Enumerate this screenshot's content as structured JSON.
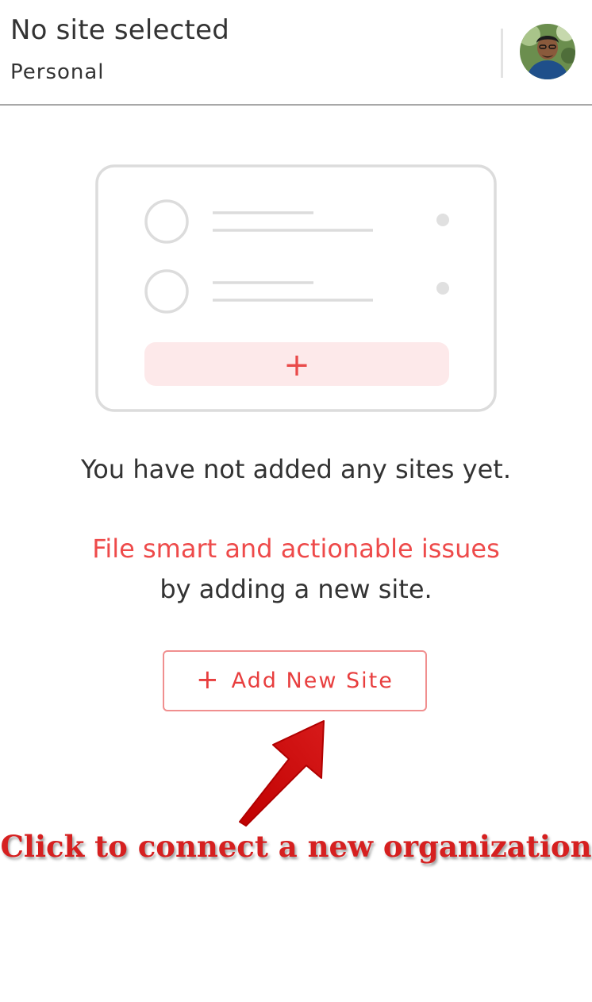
{
  "header": {
    "site_title": "No site selected",
    "site_subtitle": "Personal",
    "avatar_icon": "user-avatar"
  },
  "illustration": {
    "icon": "empty-sites-illustration",
    "plus_symbol": "+"
  },
  "empty_state": {
    "message": "You have not added any sites yet.",
    "promo_highlight": "File smart and actionable issues",
    "promo_rest": "by adding a new site."
  },
  "add_button": {
    "icon": "plus-icon",
    "plus": "+",
    "label": "Add New Site"
  },
  "annotation": {
    "text": "Click to connect a new organization",
    "arrow_icon": "red-arrow-icon"
  },
  "colors": {
    "accent_red": "#ee4a4a",
    "text_dark": "#333333",
    "illustration_gray": "#dddddd",
    "illustration_pink": "#fde9ea"
  }
}
